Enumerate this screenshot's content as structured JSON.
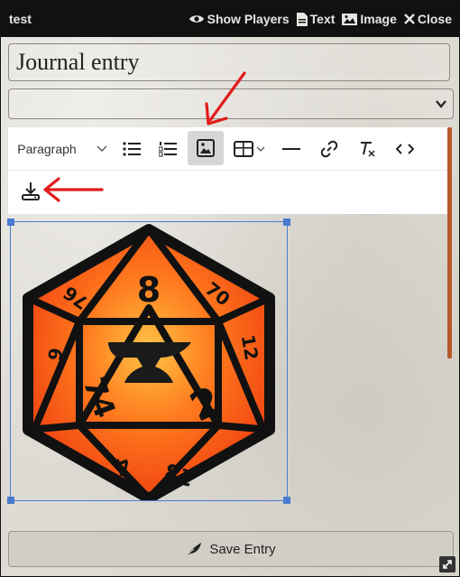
{
  "window": {
    "title": "test",
    "header_buttons": [
      {
        "label": "Show Players",
        "icon": "eye-icon"
      },
      {
        "label": "Text",
        "icon": "file-text-icon"
      },
      {
        "label": "Image",
        "icon": "image-icon"
      },
      {
        "label": "Close",
        "icon": "close-icon"
      }
    ]
  },
  "entry": {
    "title_value": "Journal entry",
    "select_value": ""
  },
  "toolbar": {
    "heading_label": "Paragraph",
    "items": [
      "bulleted-list-icon",
      "numbered-list-icon",
      "insert-image-icon",
      "insert-table-icon",
      "horizontal-line-icon",
      "link-icon",
      "remove-format-icon",
      "source-icon",
      "download-icon"
    ],
    "active_item": "insert-image-icon"
  },
  "image": {
    "die_faces": [
      "8",
      "70",
      "12",
      "2",
      "18",
      "4",
      "74",
      "6",
      "76"
    ]
  },
  "footer": {
    "save_label": "Save Entry"
  },
  "colors": {
    "accent": "#b55a2a",
    "selection": "#4a7bd0",
    "annotation_arrow": "#e11b1b",
    "die_orange": "#f05a1a"
  }
}
